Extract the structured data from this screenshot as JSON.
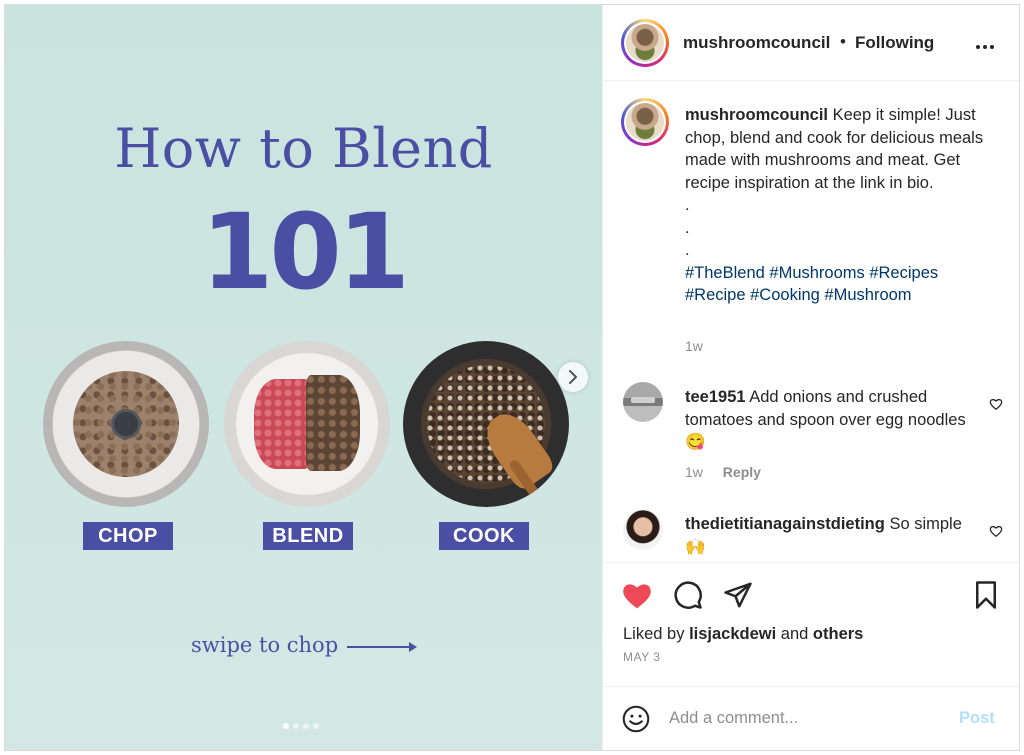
{
  "post_image": {
    "title_line1": "How to Blend",
    "title_line2": "101",
    "steps": [
      "CHOP",
      "BLEND",
      "COOK"
    ],
    "swipe_text": "swipe to chop",
    "carousel_count": 4,
    "carousel_active": 1
  },
  "header": {
    "username": "mushroomcouncil",
    "separator": "•",
    "follow_status": "Following",
    "more_icon": "more-horizontal-icon"
  },
  "caption": {
    "username": "mushroomcouncil",
    "text": "Keep it simple! Just chop, blend and cook for delicious meals made with mushrooms and meat. Get recipe inspiration at the link in bio.",
    "dots": [
      ".",
      ".",
      "."
    ],
    "hashtags": "#TheBlend #Mushrooms #Recipes #Recipe #Cooking #Mushroom",
    "time": "1w"
  },
  "comments": [
    {
      "username": "tee1951",
      "text": "Add onions and crushed tomatoes and spoon over egg noodles😋",
      "time": "1w",
      "reply": "Reply"
    },
    {
      "username": "thedietitianagainstdieting",
      "text": "So simple 🙌"
    }
  ],
  "actions": {
    "liked": true,
    "liked_prefix": "Liked by",
    "liked_user": "lisjackdewi",
    "liked_and": "and",
    "liked_others": "others",
    "date": "MAY 3",
    "like_color": "#ed4956"
  },
  "add_comment": {
    "placeholder": "Add a comment...",
    "post_label": "Post"
  }
}
